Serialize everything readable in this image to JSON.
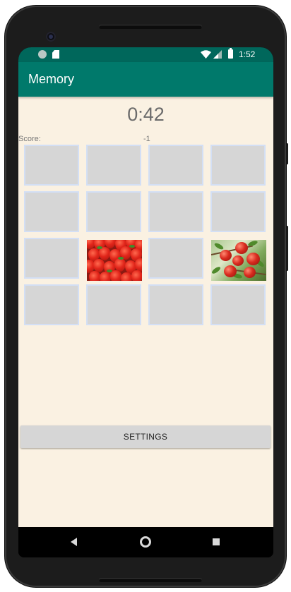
{
  "status_bar": {
    "time": "1:52",
    "icons": [
      "notification-circle-icon",
      "sd-card-icon",
      "wifi-icon",
      "signal-icon",
      "battery-icon"
    ]
  },
  "app_bar": {
    "title": "Memory",
    "color": "#00796b"
  },
  "game": {
    "timer": "0:42",
    "score_label": "Score:",
    "score_value": "-1",
    "cards": [
      {
        "state": "hidden"
      },
      {
        "state": "hidden"
      },
      {
        "state": "hidden"
      },
      {
        "state": "hidden"
      },
      {
        "state": "hidden"
      },
      {
        "state": "hidden"
      },
      {
        "state": "hidden"
      },
      {
        "state": "hidden"
      },
      {
        "state": "hidden"
      },
      {
        "state": "revealed",
        "image": "strawberries"
      },
      {
        "state": "hidden"
      },
      {
        "state": "revealed",
        "image": "apples"
      },
      {
        "state": "hidden"
      },
      {
        "state": "hidden"
      },
      {
        "state": "hidden"
      },
      {
        "state": "hidden"
      }
    ]
  },
  "settings_button": {
    "label": "SETTINGS"
  },
  "nav_bar": {
    "icons": [
      "back-icon",
      "home-icon",
      "recents-icon"
    ]
  },
  "colors": {
    "background": "#faf1e2",
    "card_face_down": "#d6d6d6",
    "card_border": "#d3dff5",
    "status_bar": "#00675b"
  }
}
